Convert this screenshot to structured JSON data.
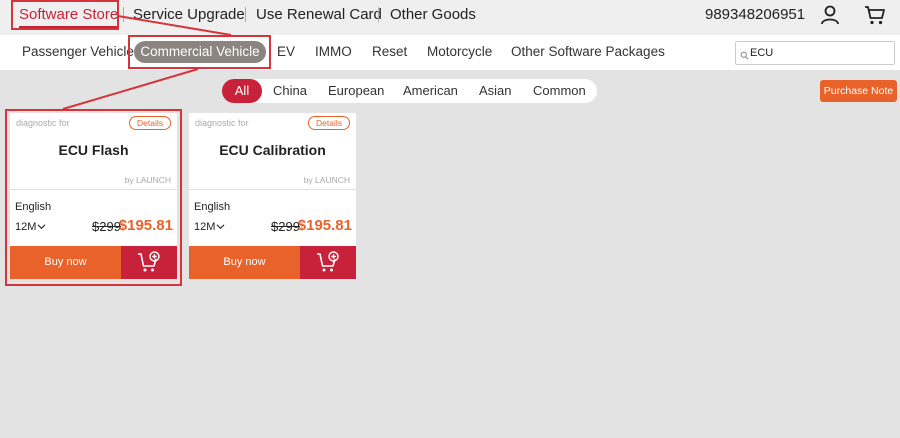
{
  "top_nav": {
    "items": [
      {
        "label": "Software Store",
        "active": true
      },
      {
        "label": "Service Upgrade",
        "active": false
      },
      {
        "label": "Use Renewal Card",
        "active": false
      },
      {
        "label": "Other Goods",
        "active": false
      }
    ],
    "phone": "989348206951",
    "icons": [
      "user-icon",
      "cart-icon"
    ]
  },
  "sub_nav": {
    "items": [
      {
        "label": "Passenger Vehicle",
        "active": false
      },
      {
        "label": "Commercial Vehicle",
        "active": true
      },
      {
        "label": "EV",
        "active": false
      },
      {
        "label": "IMMO",
        "active": false
      },
      {
        "label": "Reset",
        "active": false
      },
      {
        "label": "Motorcycle",
        "active": false
      },
      {
        "label": "Other Software Packages",
        "active": false
      }
    ],
    "search": {
      "value": "ECU",
      "icon": "search-icon"
    }
  },
  "region_filter": {
    "items": [
      {
        "label": "All",
        "active": true
      },
      {
        "label": "China",
        "active": false
      },
      {
        "label": "European",
        "active": false
      },
      {
        "label": "American",
        "active": false
      },
      {
        "label": "Asian",
        "active": false
      },
      {
        "label": "Common",
        "active": false
      }
    ]
  },
  "purchase_note": "Purchase Note",
  "products": [
    {
      "diag_label": "diagnostic for",
      "details": "Details",
      "title": "ECU Flash",
      "by": "by LAUNCH",
      "language": "English",
      "term": "12M",
      "old_price": "$299",
      "new_price": "$195.81",
      "buy_label": "Buy now",
      "cart_icon": "add-to-cart-icon"
    },
    {
      "diag_label": "diagnostic for",
      "details": "Details",
      "title": "ECU Calibration",
      "by": "by LAUNCH",
      "language": "English",
      "term": "12M",
      "old_price": "$299",
      "new_price": "$195.81",
      "buy_label": "Buy now",
      "cart_icon": "add-to-cart-icon"
    }
  ],
  "colors": {
    "accent_red": "#c8213a",
    "accent_orange": "#e8622a",
    "annotation_red": "#d4343a",
    "active_pill_gray": "#8a8580",
    "background": "#e3e3e3"
  }
}
